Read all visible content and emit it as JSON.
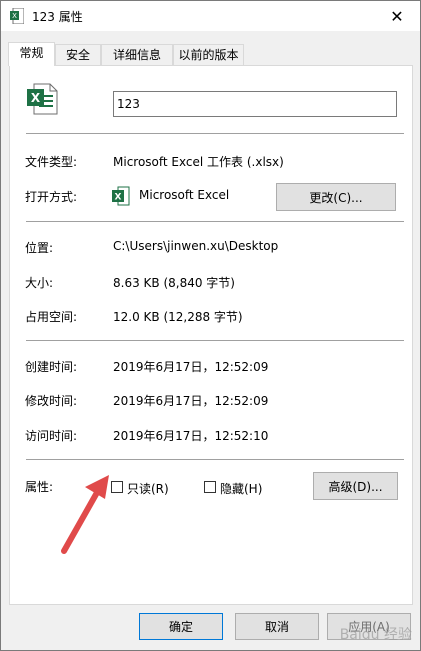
{
  "window": {
    "title": "123 属性",
    "close_glyph": "✕"
  },
  "tabs": [
    {
      "label": "常规"
    },
    {
      "label": "安全"
    },
    {
      "label": "详细信息"
    },
    {
      "label": "以前的版本"
    }
  ],
  "file": {
    "name": "123"
  },
  "info": {
    "type_label": "文件类型:",
    "type_value": "Microsoft Excel 工作表 (.xlsx)",
    "open_label": "打开方式:",
    "open_value": "Microsoft Excel",
    "change_button": "更改(C)...",
    "location_label": "位置:",
    "location_value": "C:\\Users\\jinwen.xu\\Desktop",
    "size_label": "大小:",
    "size_value": "8.63 KB (8,840 字节)",
    "disk_label": "占用空间:",
    "disk_value": "12.0 KB (12,288 字节)",
    "created_label": "创建时间:",
    "created_value": "2019年6月17日，12:52:09",
    "modified_label": "修改时间:",
    "modified_value": "2019年6月17日，12:52:09",
    "accessed_label": "访问时间:",
    "accessed_value": "2019年6月17日，12:52:10"
  },
  "attributes": {
    "label": "属性:",
    "readonly_label": "只读(R)",
    "readonly_checked": false,
    "hidden_label": "隐藏(H)",
    "hidden_checked": false,
    "advanced_button": "高级(D)..."
  },
  "footer": {
    "ok": "确定",
    "cancel": "取消",
    "apply": "应用(A)"
  },
  "watermark": "Baidu 经验",
  "colors": {
    "excel_green": "#1e7145",
    "arrow_red": "#e04a4a",
    "accent": "#0078d7"
  }
}
